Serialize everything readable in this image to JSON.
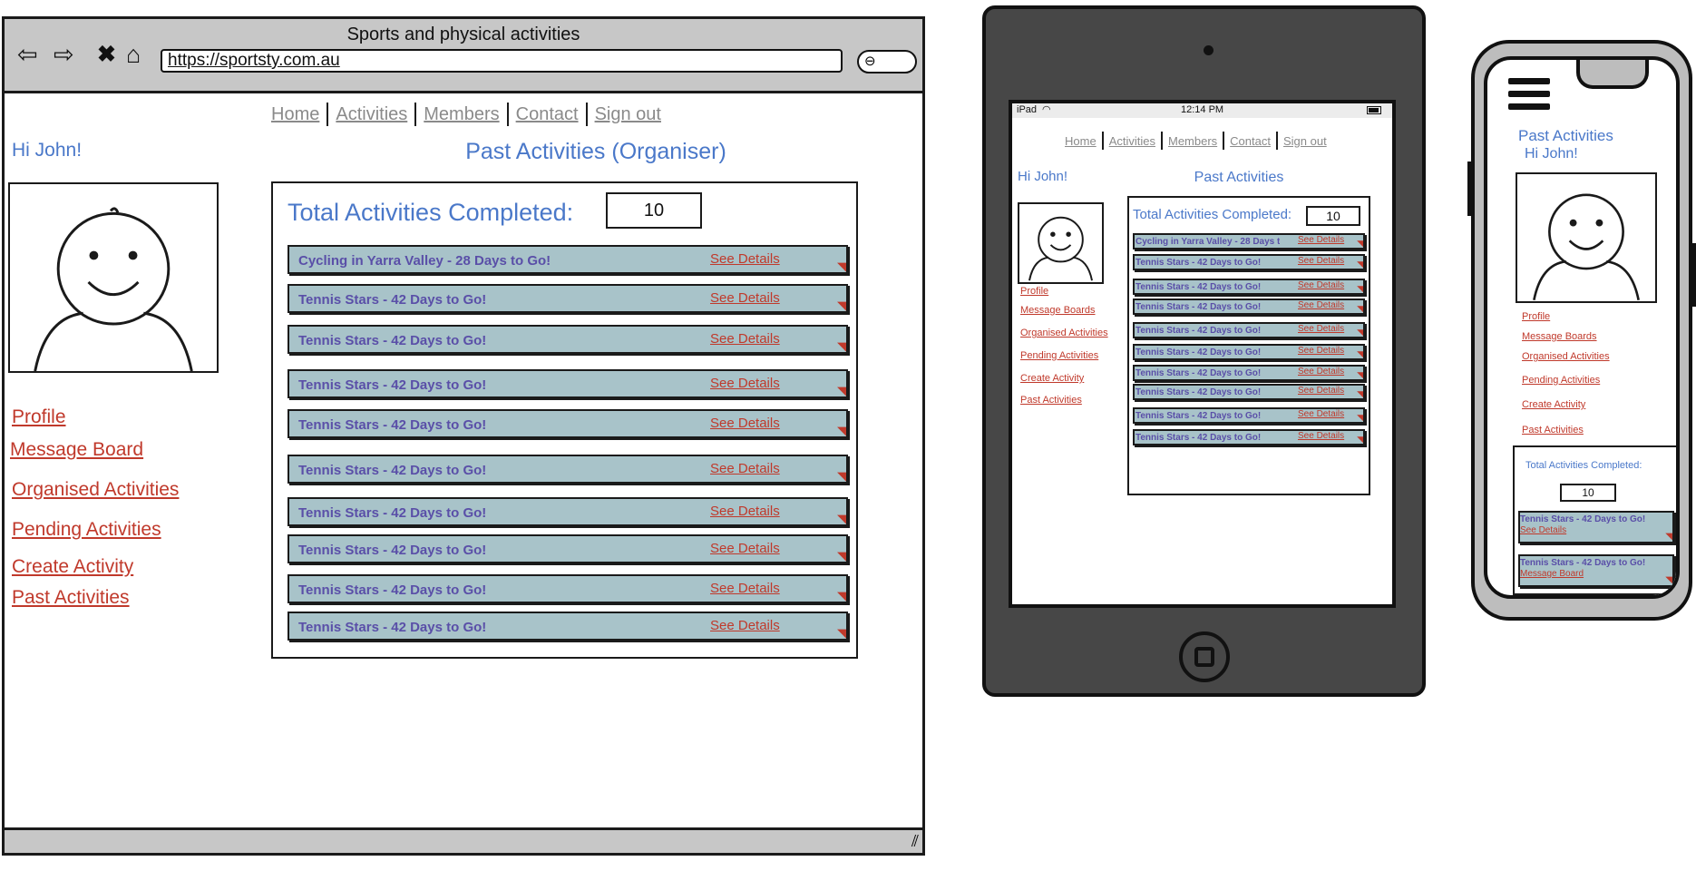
{
  "desktop": {
    "window_title": "Sports and physical activities",
    "url": "https://sportsty.com.au",
    "nav": [
      "Home",
      "Activities",
      "Members",
      "Contact",
      "Sign out"
    ],
    "greeting": "Hi John!",
    "page_title": "Past Activities (Organiser)",
    "total_label": "Total Activities Completed:",
    "total_value": "10",
    "sidebar": [
      "Profile",
      "Message Board",
      "Organised Activities",
      "Pending Activities",
      "Create Activity",
      "Past Activities"
    ],
    "rows": [
      {
        "title": "Cycling in Yarra Valley - 28 Days to Go!",
        "link": "See Details"
      },
      {
        "title": "Tennis Stars - 42 Days to Go!",
        "link": "See Details"
      },
      {
        "title": "Tennis Stars - 42 Days to Go!",
        "link": "See Details"
      },
      {
        "title": "Tennis Stars - 42 Days to Go!",
        "link": "See Details"
      },
      {
        "title": "Tennis Stars - 42 Days to Go!",
        "link": "See Details"
      },
      {
        "title": "Tennis Stars - 42 Days to Go!",
        "link": "See Details"
      },
      {
        "title": "Tennis Stars - 42 Days to Go!",
        "link": "See Details"
      },
      {
        "title": "Tennis Stars - 42 Days to Go!",
        "link": "See Details"
      },
      {
        "title": "Tennis Stars - 42 Days to Go!",
        "link": "See Details"
      },
      {
        "title": "Tennis Stars - 42 Days to Go!",
        "link": "See Details"
      }
    ]
  },
  "tablet": {
    "status_device": "iPad",
    "status_time": "12:14 PM",
    "nav": [
      "Home",
      "Activities",
      "Members",
      "Contact",
      "Sign out"
    ],
    "greeting": "Hi John!",
    "page_title": "Past Activities",
    "total_label": "Total Activities Completed:",
    "total_value": "10",
    "sidebar": [
      "Profile",
      "Message Boards",
      "Organised Activities",
      "Pending Activities",
      "Create Activity",
      "Past Activities"
    ],
    "rows": [
      {
        "title": "Cycling in Yarra Valley - 28 Days t",
        "link": "See Details"
      },
      {
        "title": "Tennis Stars - 42 Days to Go!",
        "link": "See Details"
      },
      {
        "title": "Tennis Stars - 42 Days to Go!",
        "link": "See Details"
      },
      {
        "title": "Tennis Stars - 42 Days to Go!",
        "link": "See Details"
      },
      {
        "title": "Tennis Stars - 42 Days to Go!",
        "link": "See Details"
      },
      {
        "title": "Tennis Stars - 42 Days to Go!",
        "link": "See Details"
      },
      {
        "title": "Tennis Stars - 42 Days to Go!",
        "link": "See Details"
      },
      {
        "title": "Tennis Stars - 42 Days to Go!",
        "link": "See Details"
      },
      {
        "title": "Tennis Stars - 42 Days to Go!",
        "link": "See Details"
      },
      {
        "title": "Tennis Stars - 42 Days to Go!",
        "link": "See Details"
      }
    ]
  },
  "phone": {
    "page_title": "Past Activities",
    "greeting": "Hi John!",
    "sidebar": [
      "Profile",
      "Message Boards",
      "Organised Activities",
      "Pending Activities",
      "Create Activity",
      "Past Activities"
    ],
    "total_label": "Total Activities Completed:",
    "total_value": "10",
    "rows": [
      {
        "title": "Tennis Stars - 42 Days to Go!",
        "link": "See Details"
      },
      {
        "title": "Tennis Stars - 42 Days to Go!",
        "link": "Message Board"
      }
    ]
  },
  "icons": {
    "back": "back-arrow-icon",
    "forward": "forward-arrow-icon",
    "stop": "close-icon",
    "home": "home-icon",
    "search": "search-icon",
    "resize": "resize-grip-icon",
    "row_marker": "pin-icon",
    "hamburger": "hamburger-menu-icon",
    "wifi": "wifi-icon",
    "battery": "battery-icon"
  },
  "colors": {
    "accent_blue": "#4a78c9",
    "link_red": "#c0392b",
    "row_fill": "#a8c3c9",
    "row_text": "#5a4fa8",
    "nav_gray": "#8a8a8a"
  }
}
